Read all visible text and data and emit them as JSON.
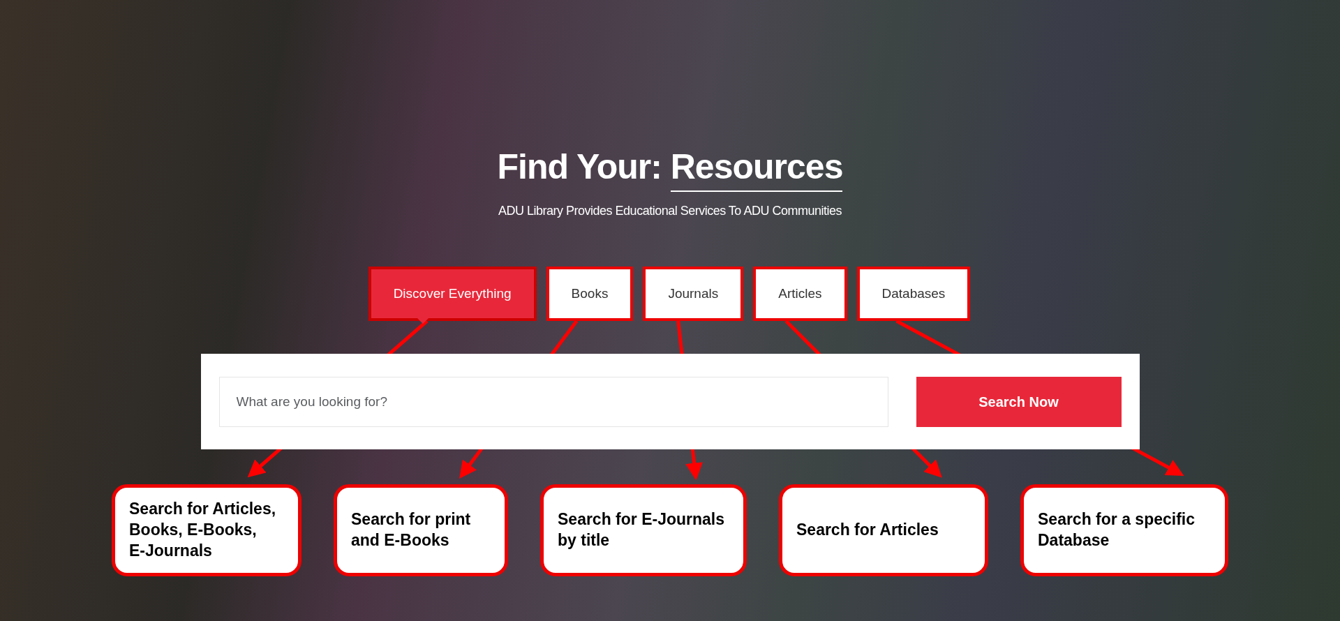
{
  "hero": {
    "title_prefix": "Find Your:",
    "title_word": "Resources",
    "subtitle": "ADU Library Provides Educational Services To ADU Communities"
  },
  "tabs": [
    {
      "label": "Discover Everything",
      "selected": true
    },
    {
      "label": "Books",
      "selected": false
    },
    {
      "label": "Journals",
      "selected": false
    },
    {
      "label": "Articles",
      "selected": false
    },
    {
      "label": "Databases",
      "selected": false
    }
  ],
  "search": {
    "placeholder": "What are you looking for?",
    "button": "Search Now"
  },
  "callouts": [
    {
      "lines": [
        "Search for Articles,",
        "Books, E-Books,",
        "E-Journals"
      ]
    },
    {
      "lines": [
        "Search for print",
        "and E-Books"
      ]
    },
    {
      "lines": [
        "Search for E-Journals",
        "by title"
      ]
    },
    {
      "lines": [
        "Search for Articles"
      ]
    },
    {
      "lines": [
        "Search for a specific",
        "Database"
      ]
    }
  ]
}
